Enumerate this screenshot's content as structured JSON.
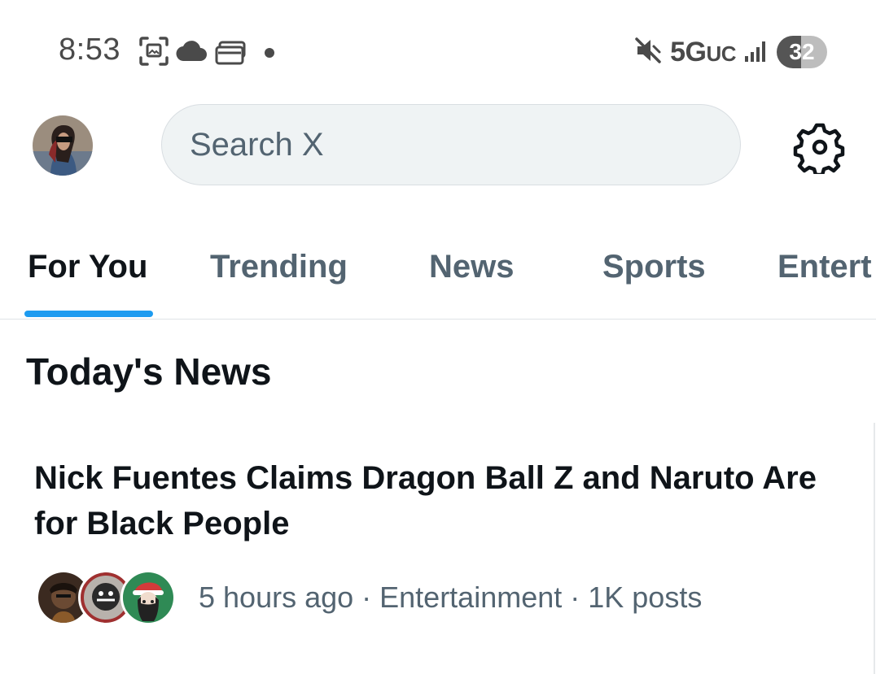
{
  "status_bar": {
    "time": "8:53",
    "network": "5G",
    "network_suffix": "UC",
    "battery": "32",
    "icons": [
      "screenshot-icon",
      "cloud-icon",
      "wallet-icon",
      "dot-icon",
      "mute-icon",
      "signal-icon"
    ]
  },
  "header": {
    "search_placeholder": "Search X",
    "icons": [
      "avatar",
      "settings-gear-icon"
    ]
  },
  "tabs": [
    {
      "label": "For You",
      "active": true
    },
    {
      "label": "Trending",
      "active": false
    },
    {
      "label": "News",
      "active": false
    },
    {
      "label": "Sports",
      "active": false
    },
    {
      "label": "Entert",
      "active": false
    }
  ],
  "section_title": "Today's News",
  "news_items": [
    {
      "headline": "Nick Fuentes Claims Dragon Ball Z and Naruto Are for Black People",
      "meta": "5 hours ago · Entertainment · 1K posts"
    }
  ],
  "colors": {
    "accent": "#1d9bf0",
    "text_primary": "#0f1419",
    "text_secondary": "#536471",
    "search_bg": "#eff3f4"
  }
}
